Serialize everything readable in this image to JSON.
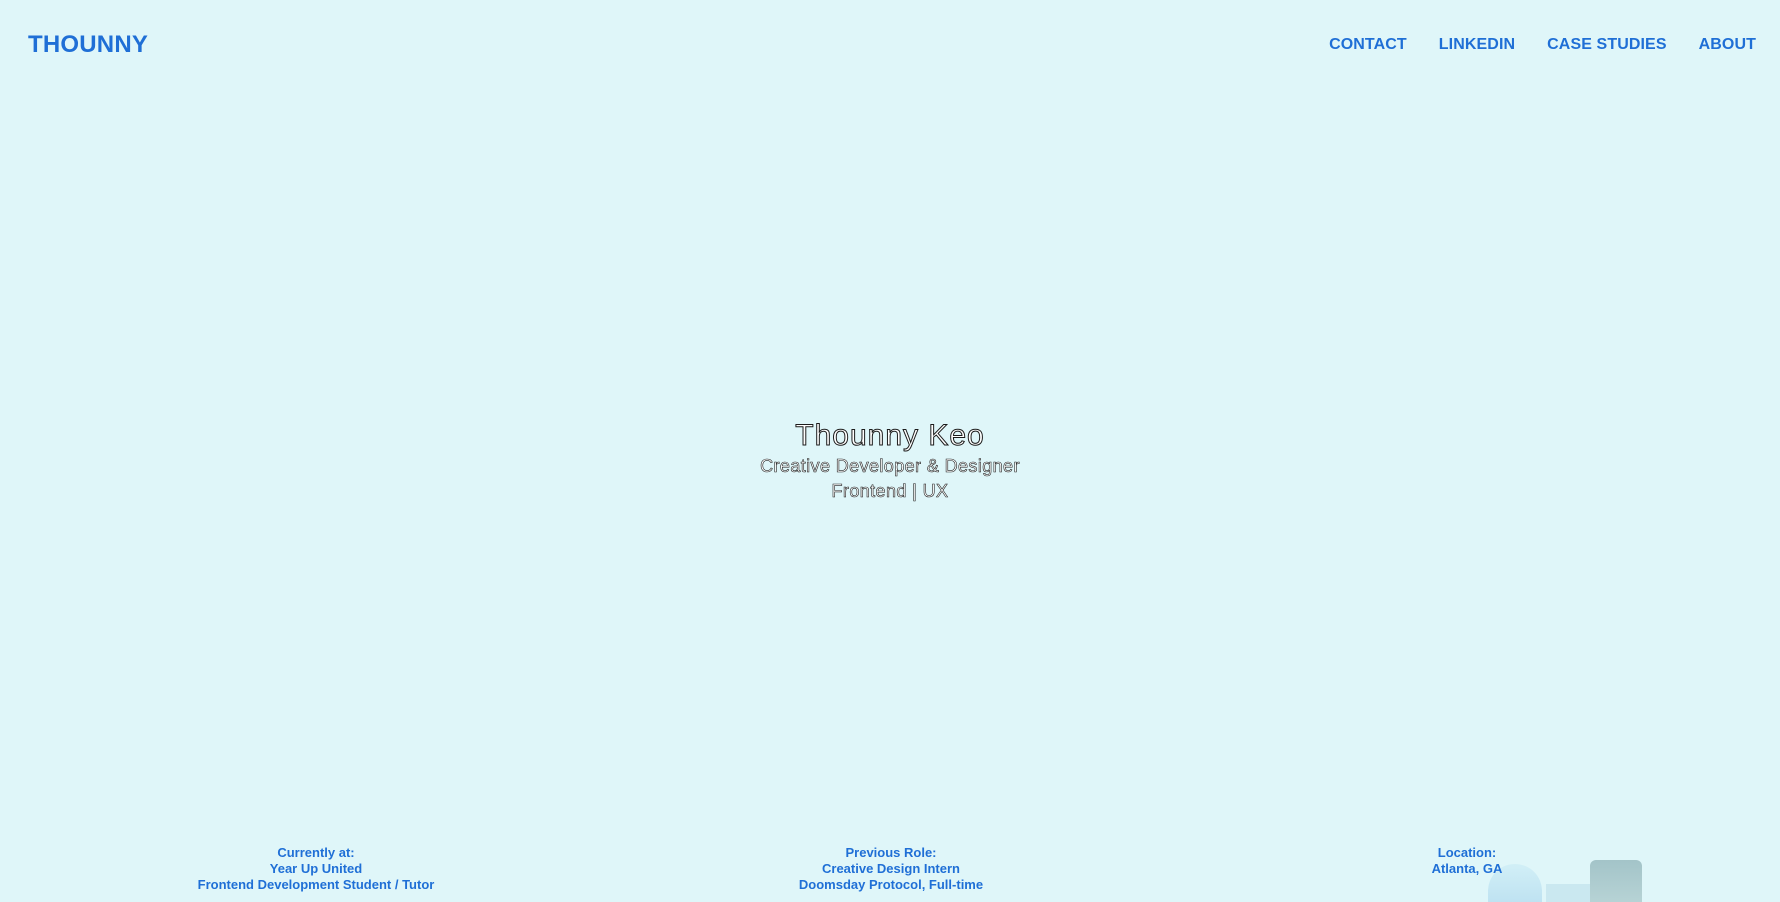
{
  "header": {
    "logo": "THOUNNY",
    "nav": [
      {
        "label": "CONTACT"
      },
      {
        "label": "LINKEDIN"
      },
      {
        "label": "CASE STUDIES"
      },
      {
        "label": "ABOUT"
      }
    ]
  },
  "hero": {
    "name": "Thounny Keo",
    "tagline": "Creative Developer & Designer",
    "focus": "Frontend | UX"
  },
  "footer_info": {
    "current": {
      "heading": "Currently at:",
      "org": "Year Up United",
      "role": "Frontend Development Student / Tutor"
    },
    "previous": {
      "heading": "Previous Role:",
      "role": "Creative Design Intern",
      "org": "Doomsday Protocol, Full-time"
    },
    "location": {
      "heading": "Location:",
      "value": "Atlanta, GA"
    }
  },
  "colors": {
    "background": "#dff6f9",
    "accent": "#1f6fd6"
  }
}
